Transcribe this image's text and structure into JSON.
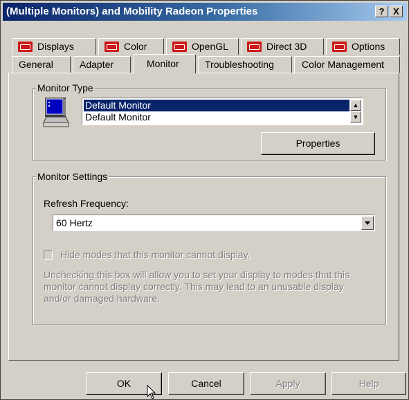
{
  "window": {
    "title": "(Multiple Monitors) and Mobility Radeon Properties",
    "help_label": "?",
    "close_label": "X"
  },
  "tabs_top": [
    {
      "label": "Displays"
    },
    {
      "label": "Color"
    },
    {
      "label": "OpenGL"
    },
    {
      "label": "Direct 3D"
    },
    {
      "label": "Options"
    }
  ],
  "tabs_bottom": [
    {
      "label": "General"
    },
    {
      "label": "Adapter"
    },
    {
      "label": "Monitor",
      "selected": true
    },
    {
      "label": "Troubleshooting"
    },
    {
      "label": "Color Management"
    }
  ],
  "monitor_type": {
    "group_label": "Monitor Type",
    "items": [
      {
        "label": "Default Monitor",
        "selected": true
      },
      {
        "label": "Default Monitor",
        "selected": false
      }
    ],
    "properties_label": "Properties"
  },
  "monitor_settings": {
    "group_label": "Monitor Settings",
    "refresh_label": "Refresh Frequency:",
    "refresh_value": "60 Hertz",
    "hide_modes_label": "Hide modes that this monitor cannot display.",
    "hide_modes_checked": false,
    "warning_text": "Unchecking this box will allow you to set your display to modes that this monitor cannot display correctly. This may lead to an unusable display and/or damaged hardware."
  },
  "buttons": {
    "ok": "OK",
    "cancel": "Cancel",
    "apply": "Apply",
    "help": "Help"
  },
  "colors": {
    "title_start": "#0a246a",
    "title_end": "#a6caf0",
    "face": "#d4d0c8",
    "selection": "#0a246a"
  }
}
